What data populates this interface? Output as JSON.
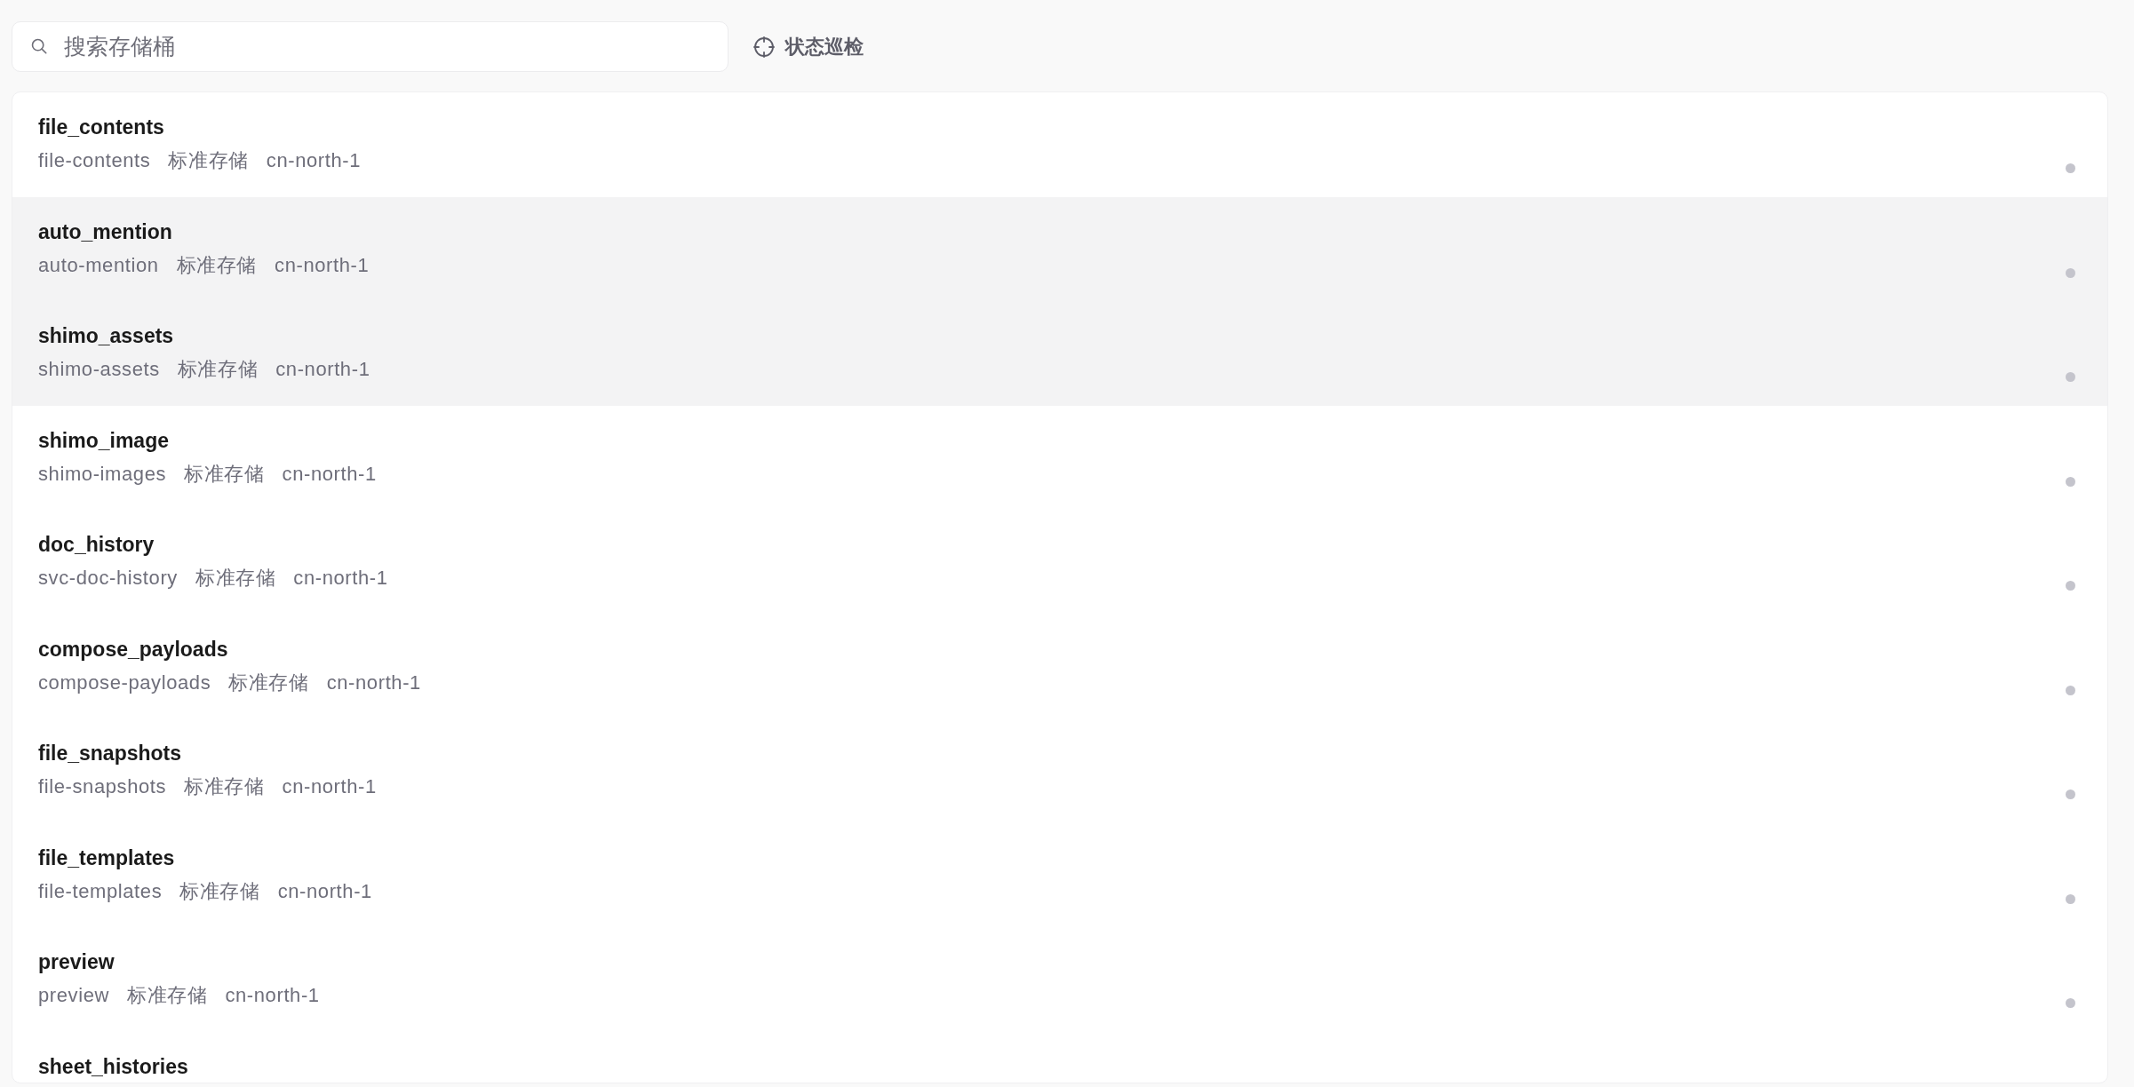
{
  "search": {
    "placeholder": "搜索存储桶"
  },
  "toolbar": {
    "status_check_button": "状态巡检"
  },
  "buckets": [
    {
      "name": "file_contents",
      "bucket": "file-contents",
      "storage_class": "标准存储",
      "region": "cn-north-1",
      "highlighted": false,
      "color": "#c4c4cc"
    },
    {
      "name": "auto_mention",
      "bucket": "auto-mention",
      "storage_class": "标准存储",
      "region": "cn-north-1",
      "highlighted": true,
      "color": "#c4c4cc"
    },
    {
      "name": "shimo_assets",
      "bucket": "shimo-assets",
      "storage_class": "标准存储",
      "region": "cn-north-1",
      "highlighted": true,
      "color": "#c4c4cc"
    },
    {
      "name": "shimo_image",
      "bucket": "shimo-images",
      "storage_class": "标准存储",
      "region": "cn-north-1",
      "highlighted": false,
      "color": "#c4c4cc"
    },
    {
      "name": "doc_history",
      "bucket": "svc-doc-history",
      "storage_class": "标准存储",
      "region": "cn-north-1",
      "highlighted": false,
      "color": "#c4c4cc"
    },
    {
      "name": "compose_payloads",
      "bucket": "compose-payloads",
      "storage_class": "标准存储",
      "region": "cn-north-1",
      "highlighted": false,
      "color": "#c4c4cc"
    },
    {
      "name": "file_snapshots",
      "bucket": "file-snapshots",
      "storage_class": "标准存储",
      "region": "cn-north-1",
      "highlighted": false,
      "color": "#c4c4cc"
    },
    {
      "name": "file_templates",
      "bucket": "file-templates",
      "storage_class": "标准存储",
      "region": "cn-north-1",
      "highlighted": false,
      "color": "#c4c4cc"
    },
    {
      "name": "preview",
      "bucket": "preview",
      "storage_class": "标准存储",
      "region": "cn-north-1",
      "highlighted": false,
      "color": "#c4c4cc"
    },
    {
      "name": "sheet_histories",
      "highlighted": false
    }
  ]
}
